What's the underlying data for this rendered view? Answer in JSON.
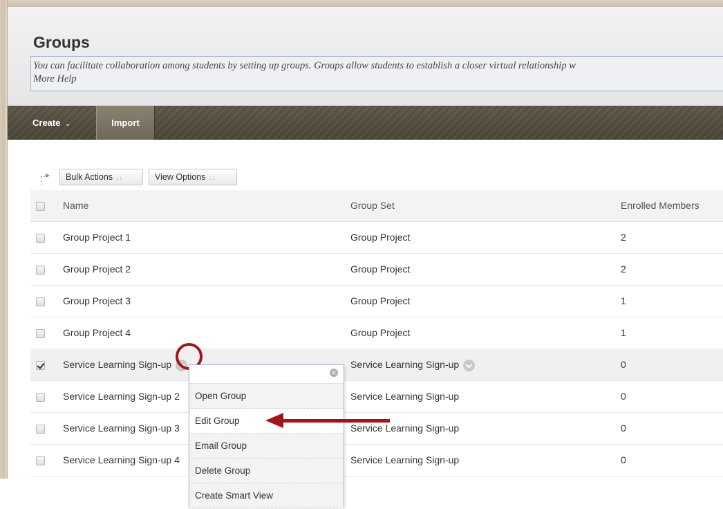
{
  "header": {
    "title": "Groups",
    "help_text": "You can facilitate collaboration among students by setting up groups. Groups allow students to establish a closer virtual relationship w",
    "more_help": "More Help"
  },
  "toolbar": {
    "create_label": "Create",
    "import_label": "Import"
  },
  "actions": {
    "bulk_label": "Bulk Actions",
    "view_label": "View Options"
  },
  "table": {
    "columns": [
      "Name",
      "Group Set",
      "Enrolled Members"
    ],
    "rows": [
      {
        "name": "Group Project 1",
        "set": "Group Project",
        "members": "2",
        "checked": false
      },
      {
        "name": "Group Project 2",
        "set": "Group Project",
        "members": "2",
        "checked": false
      },
      {
        "name": "Group Project 3",
        "set": "Group Project",
        "members": "1",
        "checked": false
      },
      {
        "name": "Group Project 4",
        "set": "Group Project",
        "members": "1",
        "checked": false
      },
      {
        "name": "Service Learning Sign-up",
        "set": "Service Learning Sign-up",
        "members": "0",
        "checked": true
      },
      {
        "name": "Service Learning Sign-up 2",
        "set": "Service Learning Sign-up",
        "members": "0",
        "checked": false
      },
      {
        "name": "Service Learning Sign-up 3",
        "set": "Service Learning Sign-up",
        "members": "0",
        "checked": false
      },
      {
        "name": "Service Learning Sign-up 4",
        "set": "Service Learning Sign-up",
        "members": "0",
        "checked": false
      }
    ]
  },
  "context_menu": {
    "items": [
      "Open Group",
      "Edit Group",
      "Email Group",
      "Delete Group",
      "Create Smart View"
    ]
  },
  "colors": {
    "accent_red": "#a3151b",
    "toolbar_dark": "#4a4437"
  }
}
